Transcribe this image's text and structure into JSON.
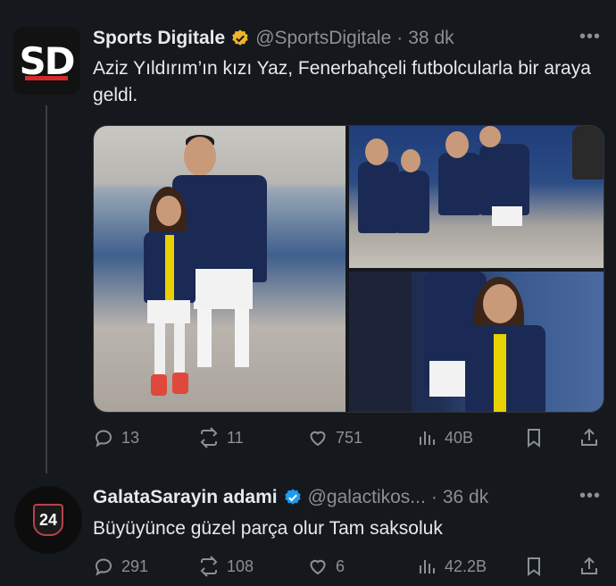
{
  "tweets": [
    {
      "author_name": "Sports Digitale",
      "handle": "@SportsDigitale",
      "separator": "·",
      "time": "38 dk",
      "avatar_text": "SD",
      "text": "Aziz Yıldırım’ın kızı Yaz, Fenerbahçeli futbolcularla bir araya geldi.",
      "stats": {
        "replies": "13",
        "retweets": "11",
        "likes": "751",
        "views": "40B"
      },
      "icons": [
        "reply-icon",
        "retweet-icon",
        "like-icon",
        "views-icon",
        "bookmark-icon",
        "share-icon"
      ]
    },
    {
      "author_name": "GalataSarayin adami",
      "handle": "@galactikos...",
      "separator": "·",
      "time": "36 dk",
      "avatar_text": "24",
      "text": "Büyüyünce güzel parça olur Tam saksoluk",
      "stats": {
        "replies": "291",
        "retweets": "108",
        "likes": "6",
        "views": "42.2B"
      },
      "icons": [
        "reply-icon",
        "retweet-icon",
        "like-icon",
        "views-icon",
        "bookmark-icon",
        "share-icon"
      ]
    }
  ],
  "colors": {
    "background": "#15181d",
    "text": "#e7e9ea",
    "muted": "#8b9096",
    "verified": "#f0b429",
    "verified_blue": "#1d9bf0",
    "brand_red": "#d32a2a"
  },
  "more_icon": "more-icon"
}
